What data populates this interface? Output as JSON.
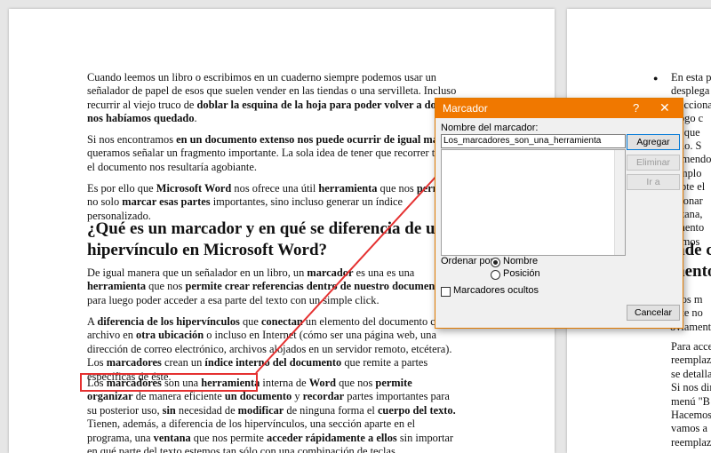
{
  "document": {
    "paragraphs": [
      "Cuando leemos un libro o escribimos en un cuaderno siempre podemos usar un señalador de papel de esos que suelen vender en las tiendas o una servilleta. Incluso recurrir al viejo truco de doblar la esquina de la hoja para poder volver a donde nos habíamos quedado.",
      "Si nos encontramos en un documento extenso nos puede ocurrir de igual manera queramos señalar un fragmento importante. La sola idea de tener que recorrer todo el documento nos resultaría agobiante.",
      "Es por ello que Microsoft Word nos ofrece una útil herramienta que nos permite no solo marcar esas partes importantes, sino incluso generar un índice personalizado.",
      "De igual manera que un señalador en un libro, un marcador es una es una herramienta que nos permite crear referencias dentro de nuestro documento para luego poder acceder a esa parte del texto con un simple click.",
      "A diferencia de los hipervínculos que conectan un elemento del documento con un archivo en otra ubicación o incluso en Internet (cómo ser una página web, una dirección de correo electrónico, archivos alojados en un servidor remoto, etcétera). Los marcadores crean un índice interno del documento que remite a partes específicas de éste.",
      "Los marcadores son una herramienta interna de Word que nos permite organizar de manera eficiente un documento y recordar partes importantes para su posterior uso, sin necesidad de modificar de ninguna forma el cuerpo del texto. Tienen, además, a diferencia de los hipervínculos, una sección aparte en el programa, una ventana que nos permite acceder rápidamente a ellos sin importar en qué parte del texto estemos tan sólo con una combinación de teclas."
    ],
    "heading": "¿Qué es un marcador y en qué se diferencia de un hipervínculo en Microsoft Word?",
    "right_page_lines": [
      "En esta p",
      "desplega",
      "elecciona",
      "álogo c",
      "ay que",
      "edio. S",
      "comendo",
      "jemplo",
      "cepte el",
      "esionar",
      "entana,",
      "omento",
      "demos"
    ],
    "right_heading_lines": [
      "nde c",
      "nento"
    ],
    "right_lines_2": [
      "n los m",
      "Este no",
      "oviamente cre"
    ],
    "right_bullets": [
      "Para acce",
      "reemplaz",
      "se detalla",
      "Si nos dir",
      "menú \"B",
      "Hacemos",
      "vamos a",
      "reemplaz"
    ]
  },
  "dialog": {
    "title": "Marcador",
    "help": "?",
    "close": "✕",
    "name_label": "Nombre del marcador:",
    "name_value": "Los_marcadores_son_una_herramienta",
    "add": "Agregar",
    "delete": "Eliminar",
    "goto": "Ir a",
    "sort_label": "Ordenar por:",
    "sort_name": "Nombre",
    "sort_position": "Posición",
    "sort_selected": "Nombre",
    "hidden": "Marcadores ocultos",
    "cancel": "Cancelar"
  },
  "colors": {
    "accent": "#f07800",
    "annotation": "#e53131",
    "page_bg": "#ffffff",
    "workspace": "#e6e6e6"
  }
}
